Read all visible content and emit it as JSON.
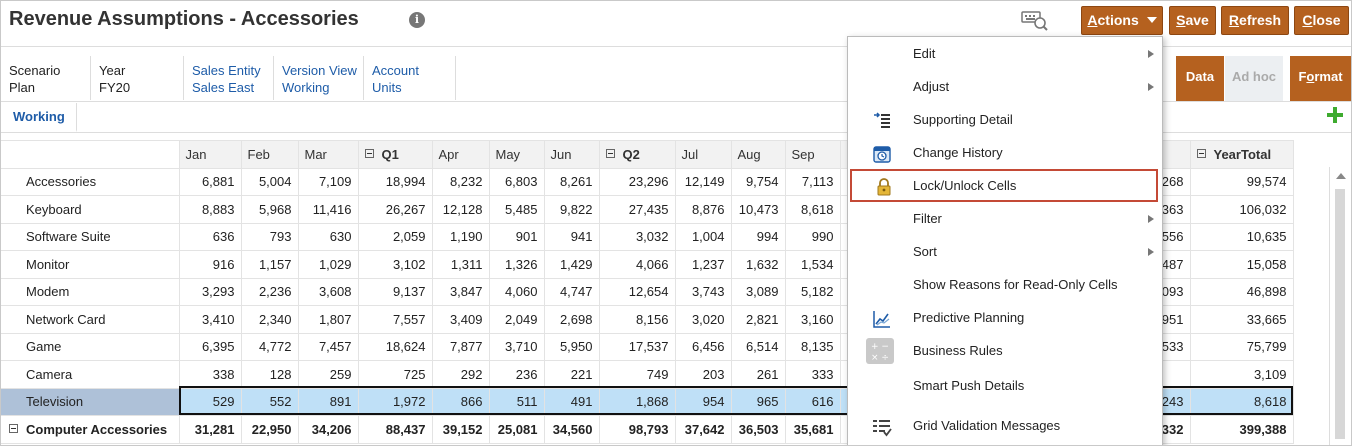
{
  "header": {
    "title": "Revenue Assumptions - Accessories",
    "actions_label": "Actions",
    "save_label": "Save",
    "refresh_label": "Refresh",
    "close_label": "Close"
  },
  "pov": [
    {
      "label": "Scenario",
      "value": "Plan"
    },
    {
      "label": "Year",
      "value": "FY20"
    },
    {
      "label": "Sales Entity",
      "value": "Sales East"
    },
    {
      "label": "Version View",
      "value": "Working"
    },
    {
      "label": "Account",
      "value": "Units"
    }
  ],
  "view_tabs": {
    "data": "Data",
    "adhoc": "Ad hoc",
    "format": "Format"
  },
  "tabs": {
    "working": "Working"
  },
  "grid": {
    "columns": [
      "Jan",
      "Feb",
      "Mar",
      "Q1",
      "Apr",
      "May",
      "Jun",
      "Q2",
      "Jul",
      "Aug",
      "Sep",
      "",
      "YearTotal"
    ],
    "rows": [
      {
        "label": "Accessories",
        "values": [
          "6,881",
          "5,004",
          "7,109",
          "18,994",
          "8,232",
          "6,803",
          "8,261",
          "23,296",
          "12,149",
          "9,754",
          "7,113",
          "268",
          "99,574"
        ]
      },
      {
        "label": "Keyboard",
        "values": [
          "8,883",
          "5,968",
          "11,416",
          "26,267",
          "12,128",
          "5,485",
          "9,822",
          "27,435",
          "8,876",
          "10,473",
          "8,618",
          "363",
          "106,032"
        ]
      },
      {
        "label": "Software Suite",
        "values": [
          "636",
          "793",
          "630",
          "2,059",
          "1,190",
          "901",
          "941",
          "3,032",
          "1,004",
          "994",
          "990",
          "556",
          "10,635"
        ]
      },
      {
        "label": "Monitor",
        "values": [
          "916",
          "1,157",
          "1,029",
          "3,102",
          "1,311",
          "1,326",
          "1,429",
          "4,066",
          "1,237",
          "1,632",
          "1,534",
          "487",
          "15,058"
        ]
      },
      {
        "label": "Modem",
        "values": [
          "3,293",
          "2,236",
          "3,608",
          "9,137",
          "3,847",
          "4,060",
          "4,747",
          "12,654",
          "3,743",
          "3,089",
          "5,182",
          "093",
          "46,898"
        ]
      },
      {
        "label": "Network Card",
        "values": [
          "3,410",
          "2,340",
          "1,807",
          "7,557",
          "3,409",
          "2,049",
          "2,698",
          "8,156",
          "3,020",
          "2,821",
          "3,160",
          "951",
          "33,665"
        ]
      },
      {
        "label": "Game",
        "values": [
          "6,395",
          "4,772",
          "7,457",
          "18,624",
          "7,877",
          "3,710",
          "5,950",
          "17,537",
          "6,456",
          "6,514",
          "8,135",
          "533",
          "75,799"
        ]
      },
      {
        "label": "Camera",
        "values": [
          "338",
          "128",
          "259",
          "725",
          "292",
          "236",
          "221",
          "749",
          "203",
          "261",
          "333",
          "",
          "3,109"
        ]
      },
      {
        "label": "Television",
        "values": [
          "529",
          "552",
          "891",
          "1,972",
          "866",
          "511",
          "491",
          "1,868",
          "954",
          "965",
          "616",
          "243",
          "8,618"
        ]
      },
      {
        "label": "Computer Accessories",
        "values": [
          "31,281",
          "22,950",
          "34,206",
          "88,437",
          "39,152",
          "25,081",
          "34,560",
          "98,793",
          "37,642",
          "36,503",
          "35,681",
          "332",
          "399,388"
        ]
      }
    ]
  },
  "menu": {
    "items": [
      {
        "label": "Edit",
        "icon": "",
        "submenu": true
      },
      {
        "label": "Adjust",
        "icon": "",
        "submenu": true
      },
      {
        "label": "Supporting Detail",
        "icon": "supporting-detail-icon",
        "submenu": false
      },
      {
        "label": "Change History",
        "icon": "change-history-icon",
        "submenu": false
      },
      {
        "label": "Lock/Unlock Cells",
        "icon": "lock-icon",
        "submenu": false
      },
      {
        "label": "Filter",
        "icon": "",
        "submenu": true
      },
      {
        "label": "Sort",
        "icon": "",
        "submenu": true
      },
      {
        "label": "Show Reasons for Read-Only Cells",
        "icon": "",
        "submenu": false
      },
      {
        "label": "Predictive Planning",
        "icon": "predictive-planning-icon",
        "submenu": false
      },
      {
        "label": "Business Rules",
        "icon": "calculator-icon",
        "submenu": false
      },
      {
        "label": "Smart Push Details",
        "icon": "",
        "submenu": false
      },
      {
        "label": "Grid Validation Messages",
        "icon": "grid-validation-icon",
        "submenu": false
      }
    ]
  },
  "colors": {
    "accent": "#b5611f",
    "link": "#1e5ca8",
    "selected_row": "#bfe0f7",
    "highlight": "#c44a36"
  }
}
